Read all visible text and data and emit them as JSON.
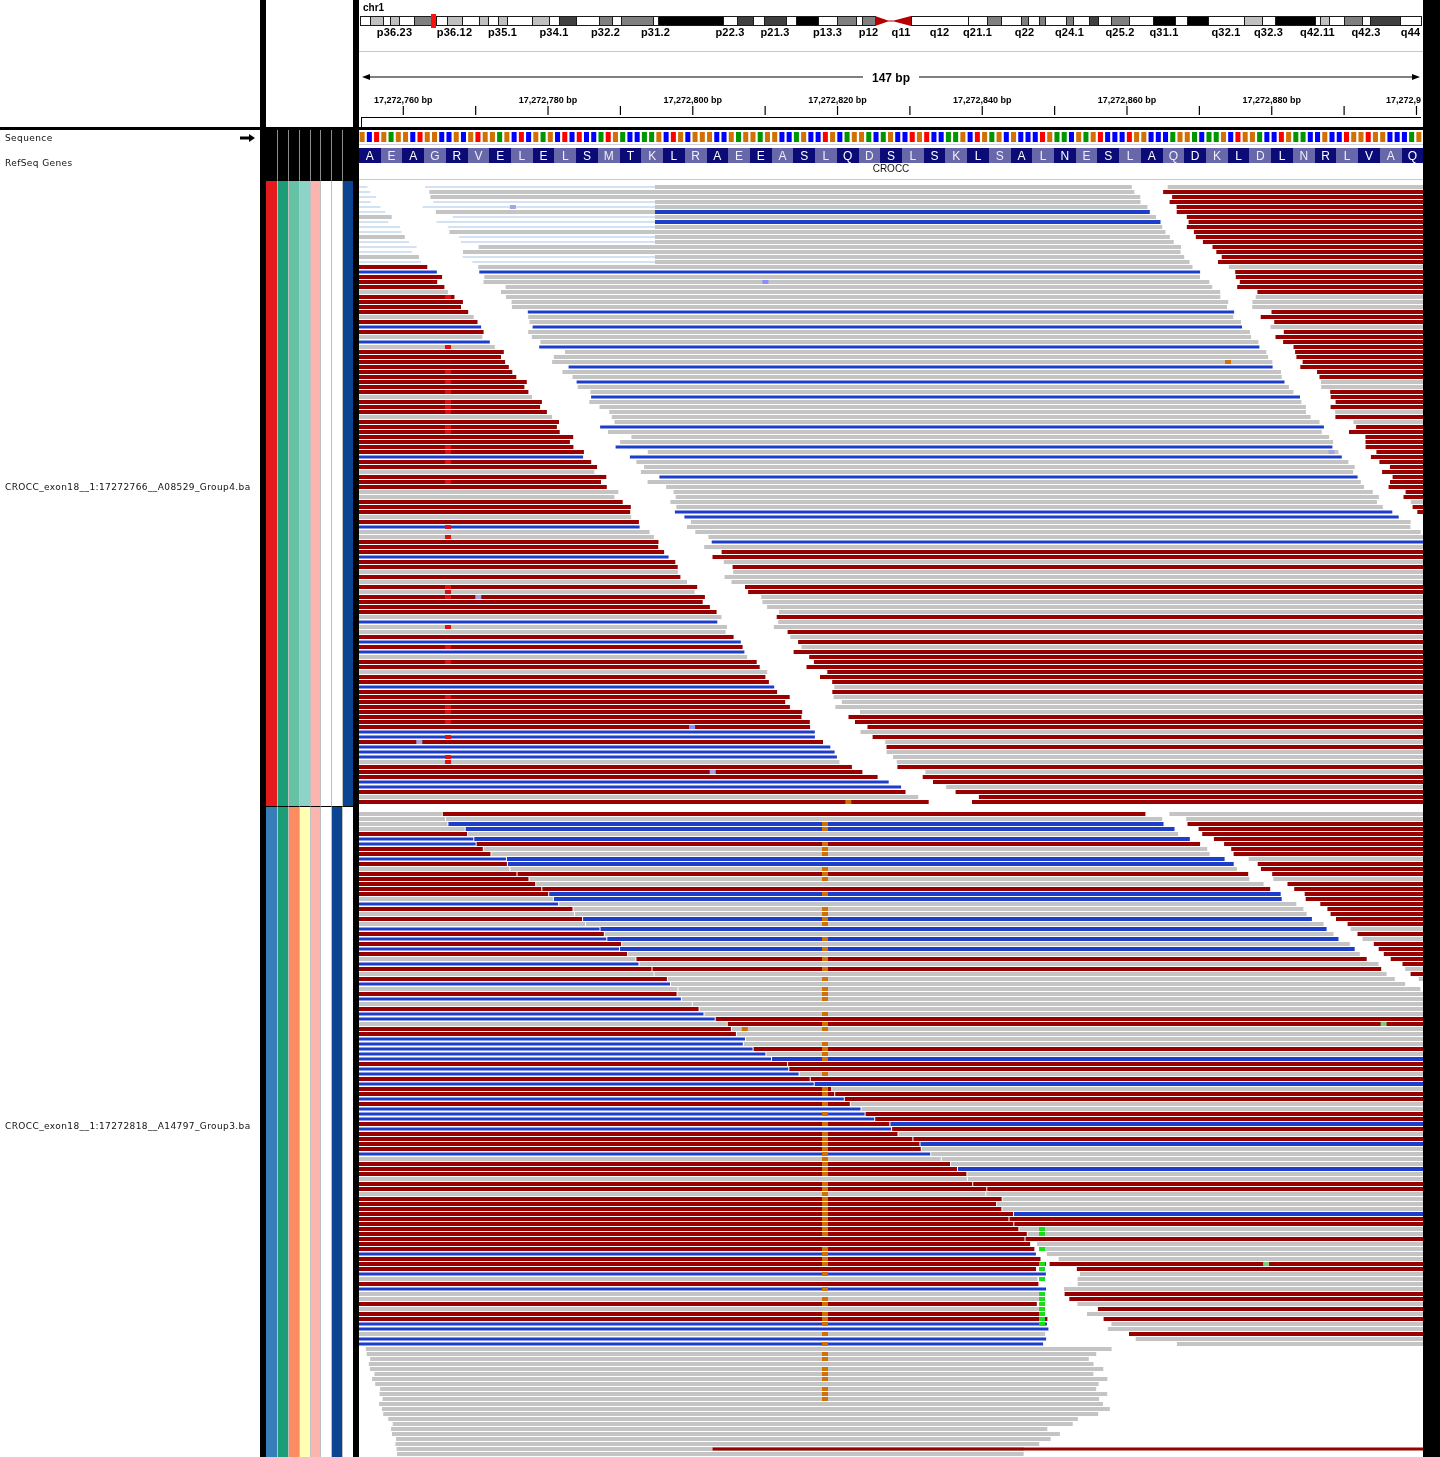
{
  "ideogram": {
    "chromosome": "chr1",
    "view_marker": true,
    "bands": [
      {
        "kind": "band",
        "color": "#ffffff"
      },
      {
        "kind": "band",
        "color": "#c0c0c0"
      },
      {
        "kind": "band",
        "color": "#ffffff"
      },
      {
        "kind": "band",
        "color": "#c0c0c0",
        "label": "p36.23"
      },
      {
        "kind": "band",
        "color": "#ffffff"
      },
      {
        "kind": "band",
        "color": "#808080"
      },
      {
        "kind": "band",
        "color": "#ffffff"
      },
      {
        "kind": "band",
        "color": "#c0c0c0",
        "label": "p36.12"
      },
      {
        "kind": "band",
        "color": "#ffffff"
      },
      {
        "kind": "band",
        "color": "#c0c0c0"
      },
      {
        "kind": "band",
        "color": "#ffffff"
      },
      {
        "kind": "band",
        "color": "#c0c0c0",
        "label": "p35.1"
      },
      {
        "kind": "band",
        "color": "#ffffff"
      },
      {
        "kind": "band",
        "color": "#c0c0c0"
      },
      {
        "kind": "band",
        "color": "#ffffff",
        "label": "p34.1"
      },
      {
        "kind": "band",
        "color": "#404040"
      },
      {
        "kind": "band",
        "color": "#ffffff"
      },
      {
        "kind": "band",
        "color": "#808080",
        "label": "p32.2"
      },
      {
        "kind": "band",
        "color": "#ffffff"
      },
      {
        "kind": "band",
        "color": "#808080"
      },
      {
        "kind": "band",
        "color": "#ffffff",
        "label": "p31.2"
      },
      {
        "kind": "band",
        "color": "#000000"
      },
      {
        "kind": "band",
        "color": "#ffffff",
        "label": "p22.3"
      },
      {
        "kind": "band",
        "color": "#404040"
      },
      {
        "kind": "band",
        "color": "#ffffff"
      },
      {
        "kind": "band",
        "color": "#404040",
        "label": "p21.3"
      },
      {
        "kind": "band",
        "color": "#ffffff"
      },
      {
        "kind": "band",
        "color": "#000000"
      },
      {
        "kind": "band",
        "color": "#ffffff",
        "label": "p13.3"
      },
      {
        "kind": "band",
        "color": "#808080"
      },
      {
        "kind": "band",
        "color": "#ffffff"
      },
      {
        "kind": "band",
        "color": "#808080",
        "label": "p12"
      },
      {
        "kind": "pcen",
        "color": "#b40000"
      },
      {
        "kind": "qcen",
        "color": "#b40000",
        "label": "q11"
      },
      {
        "kind": "band",
        "color": "#ffffff",
        "label": "q12"
      },
      {
        "kind": "band",
        "color": "#ffffff",
        "label": "q21.1"
      },
      {
        "kind": "band",
        "color": "#808080"
      },
      {
        "kind": "band",
        "color": "#ffffff"
      },
      {
        "kind": "band",
        "color": "#808080",
        "label": "q22"
      },
      {
        "kind": "band",
        "color": "#ffffff"
      },
      {
        "kind": "band",
        "color": "#808080"
      },
      {
        "kind": "band",
        "color": "#ffffff"
      },
      {
        "kind": "band",
        "color": "#808080",
        "label": "q24.1"
      },
      {
        "kind": "band",
        "color": "#ffffff"
      },
      {
        "kind": "band",
        "color": "#404040"
      },
      {
        "kind": "band",
        "color": "#ffffff"
      },
      {
        "kind": "band",
        "color": "#808080",
        "label": "q25.2"
      },
      {
        "kind": "band",
        "color": "#ffffff"
      },
      {
        "kind": "band",
        "color": "#000000",
        "label": "q31.1"
      },
      {
        "kind": "band",
        "color": "#ffffff"
      },
      {
        "kind": "band",
        "color": "#000000"
      },
      {
        "kind": "band",
        "color": "#ffffff",
        "label": "q32.1"
      },
      {
        "kind": "band",
        "color": "#c0c0c0"
      },
      {
        "kind": "band",
        "color": "#ffffff",
        "label": "q32.3"
      },
      {
        "kind": "band",
        "color": "#000000"
      },
      {
        "kind": "band",
        "color": "#ffffff",
        "label": "q42.11"
      },
      {
        "kind": "band",
        "color": "#c0c0c0"
      },
      {
        "kind": "band",
        "color": "#ffffff"
      },
      {
        "kind": "band",
        "color": "#808080"
      },
      {
        "kind": "band",
        "color": "#ffffff",
        "label": "q42.3"
      },
      {
        "kind": "band",
        "color": "#404040"
      },
      {
        "kind": "band",
        "color": "#ffffff",
        "label": "q44"
      }
    ]
  },
  "ruler": {
    "span": "147 bp",
    "ticks": [
      "17,272,760 bp",
      "17,272,780 bp",
      "17,272,800 bp",
      "17,272,820 bp",
      "17,272,840 bp",
      "17,272,860 bp",
      "17,272,880 bp",
      "17,272,9"
    ]
  },
  "tracks": [
    {
      "kind": "sequence",
      "name": "Sequence",
      "forward": true,
      "bases": [
        {
          "color": "#d17105"
        },
        {
          "color": "#0000ff"
        },
        {
          "color": "#ff0000"
        },
        {
          "color": "#d17105"
        },
        {
          "color": "#009600"
        },
        {
          "color": "#d17105"
        },
        {
          "color": "#d17105"
        },
        {
          "color": "#0000ff"
        },
        {
          "color": "#ff0000"
        },
        {
          "color": "#d17105"
        },
        {
          "color": "#d17105"
        },
        {
          "color": "#0000ff"
        },
        {
          "color": "#0000ff"
        },
        {
          "color": "#d17105"
        },
        {
          "color": "#0000ff"
        },
        {
          "color": "#d17105"
        },
        {
          "color": "#ff0000"
        },
        {
          "color": "#d17105"
        },
        {
          "color": "#d17105"
        },
        {
          "color": "#009600"
        },
        {
          "color": "#d17105"
        },
        {
          "color": "#0000ff"
        },
        {
          "color": "#ff0000"
        },
        {
          "color": "#0000ff"
        },
        {
          "color": "#d17105"
        },
        {
          "color": "#009600"
        },
        {
          "color": "#d17105"
        },
        {
          "color": "#0000ff"
        },
        {
          "color": "#ff0000"
        },
        {
          "color": "#0000ff"
        },
        {
          "color": "#ff0000"
        },
        {
          "color": "#0000ff"
        },
        {
          "color": "#0000ff"
        },
        {
          "color": "#009600"
        },
        {
          "color": "#ff0000"
        },
        {
          "color": "#d17105"
        },
        {
          "color": "#009600"
        },
        {
          "color": "#0000ff"
        },
        {
          "color": "#0000ff"
        },
        {
          "color": "#009600"
        },
        {
          "color": "#009600"
        },
        {
          "color": "#d17105"
        },
        {
          "color": "#0000ff"
        },
        {
          "color": "#ff0000"
        },
        {
          "color": "#d17105"
        },
        {
          "color": "#0000ff"
        },
        {
          "color": "#d17105"
        },
        {
          "color": "#d17105"
        },
        {
          "color": "#d17105"
        },
        {
          "color": "#0000ff"
        },
        {
          "color": "#0000ff"
        },
        {
          "color": "#d17105"
        },
        {
          "color": "#009600"
        },
        {
          "color": "#d17105"
        },
        {
          "color": "#d17105"
        },
        {
          "color": "#009600"
        },
        {
          "color": "#d17105"
        },
        {
          "color": "#d17105"
        },
        {
          "color": "#0000ff"
        },
        {
          "color": "#0000ff"
        },
        {
          "color": "#009600"
        },
        {
          "color": "#d17105"
        },
        {
          "color": "#0000ff"
        },
        {
          "color": "#0000ff"
        },
        {
          "color": "#ff0000"
        },
        {
          "color": "#d17105"
        },
        {
          "color": "#0000ff"
        },
        {
          "color": "#009600"
        },
        {
          "color": "#d17105"
        },
        {
          "color": "#d17105"
        },
        {
          "color": "#009600"
        },
        {
          "color": "#0000ff"
        },
        {
          "color": "#009600"
        },
        {
          "color": "#d17105"
        },
        {
          "color": "#0000ff"
        },
        {
          "color": "#0000ff"
        },
        {
          "color": "#ff0000"
        },
        {
          "color": "#d17105"
        },
        {
          "color": "#ff0000"
        },
        {
          "color": "#0000ff"
        },
        {
          "color": "#0000ff"
        },
        {
          "color": "#009600"
        },
        {
          "color": "#009600"
        },
        {
          "color": "#d17105"
        },
        {
          "color": "#0000ff"
        },
        {
          "color": "#ff0000"
        },
        {
          "color": "#d17105"
        },
        {
          "color": "#009600"
        },
        {
          "color": "#d17105"
        },
        {
          "color": "#0000ff"
        },
        {
          "color": "#d17105"
        },
        {
          "color": "#0000ff"
        },
        {
          "color": "#0000ff"
        },
        {
          "color": "#0000ff"
        },
        {
          "color": "#ff0000"
        },
        {
          "color": "#d17105"
        },
        {
          "color": "#009600"
        },
        {
          "color": "#009600"
        },
        {
          "color": "#0000ff"
        },
        {
          "color": "#d17105"
        },
        {
          "color": "#009600"
        },
        {
          "color": "#d17105"
        },
        {
          "color": "#ff0000"
        },
        {
          "color": "#0000ff"
        },
        {
          "color": "#0000ff"
        },
        {
          "color": "#0000ff"
        },
        {
          "color": "#ff0000"
        },
        {
          "color": "#d17105"
        },
        {
          "color": "#d17105"
        },
        {
          "color": "#0000ff"
        },
        {
          "color": "#0000ff"
        },
        {
          "color": "#0000ff"
        },
        {
          "color": "#009600"
        },
        {
          "color": "#d17105"
        },
        {
          "color": "#d17105"
        },
        {
          "color": "#009600"
        },
        {
          "color": "#0000ff"
        },
        {
          "color": "#009600"
        },
        {
          "color": "#009600"
        },
        {
          "color": "#d17105"
        },
        {
          "color": "#0000ff"
        },
        {
          "color": "#ff0000"
        },
        {
          "color": "#d17105"
        },
        {
          "color": "#d17105"
        },
        {
          "color": "#009600"
        },
        {
          "color": "#0000ff"
        },
        {
          "color": "#0000ff"
        },
        {
          "color": "#ff0000"
        },
        {
          "color": "#d17105"
        },
        {
          "color": "#009600"
        },
        {
          "color": "#009600"
        },
        {
          "color": "#0000ff"
        },
        {
          "color": "#0000ff"
        },
        {
          "color": "#d17105"
        },
        {
          "color": "#0000ff"
        },
        {
          "color": "#0000ff"
        },
        {
          "color": "#ff0000"
        },
        {
          "color": "#d17105"
        },
        {
          "color": "#d17105"
        },
        {
          "color": "#ff0000"
        },
        {
          "color": "#d17105"
        },
        {
          "color": "#d17105"
        },
        {
          "color": "#0000ff"
        },
        {
          "color": "#0000ff"
        },
        {
          "color": "#0000ff"
        },
        {
          "color": "#009600"
        },
        {
          "color": "#d17105"
        }
      ]
    },
    {
      "kind": "gene",
      "name": "RefSeq Genes",
      "gene": "CROCC",
      "amino_acids": [
        "A",
        "E",
        "A",
        "G",
        "R",
        "V",
        "E",
        "L",
        "E",
        "L",
        "S",
        "M",
        "T",
        "K",
        "L",
        "R",
        "A",
        "E",
        "E",
        "A",
        "S",
        "L",
        "Q",
        "D",
        "S",
        "L",
        "S",
        "K",
        "L",
        "S",
        "A",
        "L",
        "N",
        "E",
        "S",
        "L",
        "A",
        "Q",
        "D",
        "K",
        "L",
        "D",
        "L",
        "N",
        "R",
        "L",
        "V",
        "A",
        "Q"
      ]
    },
    {
      "kind": "alignment",
      "name": "CROCC_exon18__1:17272766__A08529_Group4.ba",
      "attributes": [
        {
          "color": "#e41a1c"
        },
        {
          "color": "#1b9e77"
        },
        {
          "color": "#66c2a5"
        },
        {
          "color": "#8dd3c7"
        },
        {
          "color": "#fbb4ae"
        },
        {
          "color": "#ffffff"
        },
        {
          "color": "#ffffff"
        },
        {
          "color": "#0b4592"
        }
      ]
    },
    {
      "kind": "alignment",
      "name": "CROCC_exon18__1:17272818__A14797_Group3.ba",
      "attributes": [
        {
          "color": "#377eb8"
        },
        {
          "color": "#1b9e77"
        },
        {
          "color": "#fc8d62"
        },
        {
          "color": "#ffffb3"
        },
        {
          "color": "#fbb4ae"
        },
        {
          "color": "#ffffff"
        },
        {
          "color": "#0b4592"
        },
        {
          "color": "#ffffff"
        }
      ]
    }
  ]
}
